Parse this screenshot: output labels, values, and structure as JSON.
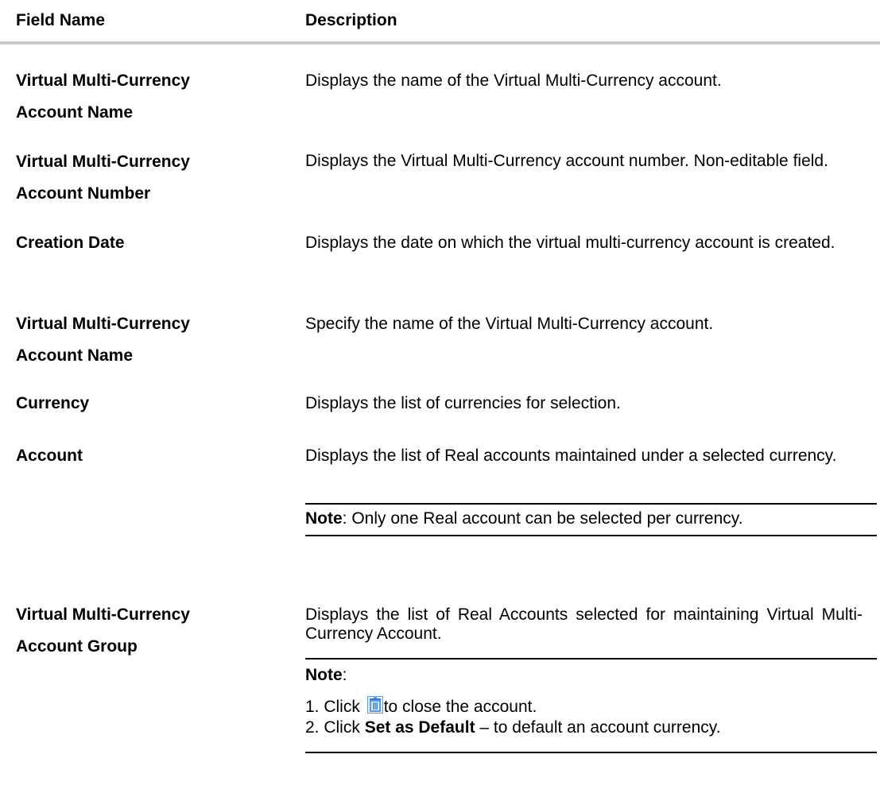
{
  "table": {
    "header": {
      "field_name": "Field Name",
      "description": "Description"
    },
    "rows": [
      {
        "name_line1": "Virtual Multi-Currency",
        "name_line2": "Account Name",
        "description": "Displays the name of the Virtual Multi-Currency account."
      },
      {
        "name_line1": "Virtual Multi-Currency",
        "name_line2": "Account Number",
        "description": "Displays the Virtual Multi-Currency account number. Non-editable field."
      },
      {
        "name_line1": "Creation Date",
        "description": "Displays the date on which the virtual multi-currency account is created."
      },
      {
        "name_line1": "Virtual Multi-Currency",
        "name_line2": "Account Name",
        "description": "Specify the name of the Virtual Multi-Currency account."
      },
      {
        "name_line1": "Currency",
        "description": "Displays the list of currencies for selection."
      },
      {
        "name_line1": "Account",
        "description": "Displays the list of Real accounts maintained under a selected currency.",
        "note": {
          "label": "Note",
          "text": ": Only one Real account can be selected per currency."
        }
      },
      {
        "name_line1": "Virtual Multi-Currency",
        "name_line2": "Account Group",
        "description": "Displays the list of Real Accounts selected for maintaining Virtual Multi-Currency Account.",
        "note": {
          "label": "Note",
          "colon": ":",
          "item1_prefix": "1. Click ",
          "item1_icon": "trash-icon",
          "item1_suffix": "to close the account.",
          "item2_prefix": "2. Click ",
          "item2_bold": "Set as Default",
          "item2_suffix": " – to default an account currency."
        }
      }
    ]
  },
  "colors": {
    "header_rule": "#c8c8c8",
    "text": "#000000",
    "icon_blue": "#2f7ed8"
  }
}
